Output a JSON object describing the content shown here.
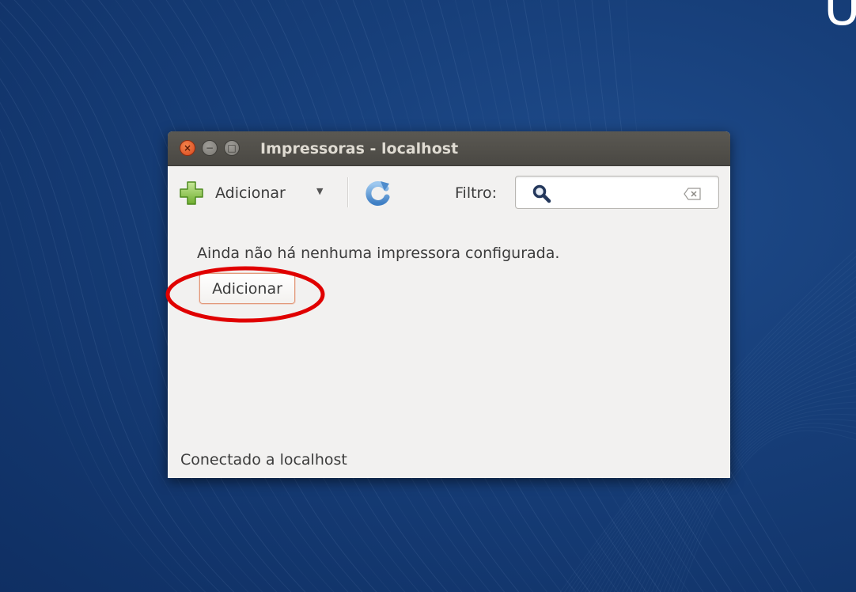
{
  "desktop": {
    "corner_glyph": "U"
  },
  "window": {
    "title": "Impressoras - localhost",
    "controls": {
      "close_glyph": "×",
      "minimize_glyph": "−",
      "maximize_glyph": "□"
    }
  },
  "toolbar": {
    "add_label": "Adicionar",
    "add_icon": "plus-icon",
    "dropdown_arrow": "▼",
    "refresh_icon": "refresh-icon",
    "filter_label": "Filtro:",
    "filter_value": "",
    "search_icon": "search-icon",
    "clear_icon": "clear-icon"
  },
  "content": {
    "empty_message": "Ainda não há nenhuma impressora configurada.",
    "add_button_label": "Adicionar"
  },
  "status": {
    "text": "Conectado a localhost"
  },
  "colors": {
    "titlebar": "#4f4d48",
    "window_bg": "#f2f1f0",
    "close_button": "#e5552a",
    "highlight": "#e00000",
    "desktop": "#173f7a"
  }
}
